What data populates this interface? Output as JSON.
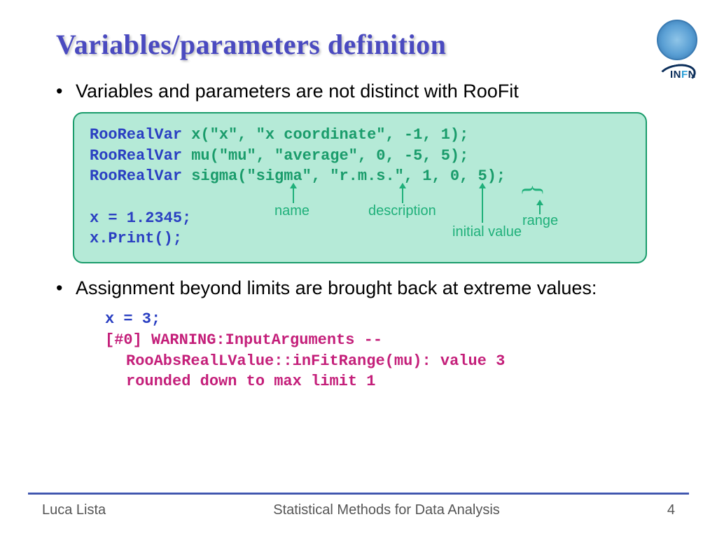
{
  "title": "Variables/parameters definition",
  "bullets": {
    "b1": "Variables and parameters are not distinct with RooFit",
    "b2": "Assignment beyond limits are brought back at extreme values:"
  },
  "code": {
    "l1_kw": "RooRealVar",
    "l1_rest": " x(\"x\", \"x coordinate\", -1, 1);",
    "l2_kw": "RooRealVar",
    "l2_rest": " mu(\"mu\", \"average\", 0, -5, 5);",
    "l3_kw": "RooRealVar",
    "l3_rest": " sigma(\"sigma\", \"r.m.s.\", 1, 0, 5);",
    "l4": "x = 1.2345;",
    "l5": "x.Print();"
  },
  "annotations": {
    "name": "name",
    "description": "description",
    "initial_value": "initial value",
    "range": "range"
  },
  "snippet2": {
    "assign": "x = 3;",
    "warn1": "[#0] WARNING:InputArguments --",
    "warn2": "RooAbsRealLValue::inFitRange(mu): value 3",
    "warn3": "rounded down to max limit 1"
  },
  "footer": {
    "author": "Luca Lista",
    "course": "Statistical Methods for Data Analysis",
    "page": "4"
  },
  "logos": {
    "infn": "INFN"
  }
}
